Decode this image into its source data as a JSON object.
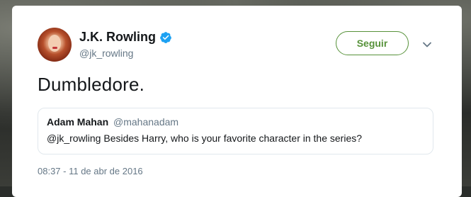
{
  "tweet": {
    "author": {
      "display_name": "J.K. Rowling",
      "handle": "@jk_rowling",
      "verified": true
    },
    "follow_label": "Seguir",
    "text": "Dumbledore.",
    "timestamp": "08:37 - 11 de abr de 2016"
  },
  "quoted_tweet": {
    "author_name": "Adam Mahan",
    "author_handle": "@mahanadam",
    "text": "@jk_rowling Besides Harry, who is your favorite character in the series?"
  },
  "icons": {
    "verified": "verified-badge-icon",
    "caret": "chevron-down-icon"
  },
  "colors": {
    "follow_accent": "#57923a",
    "verified_badge": "#1da1f2",
    "secondary_text": "#657786"
  }
}
